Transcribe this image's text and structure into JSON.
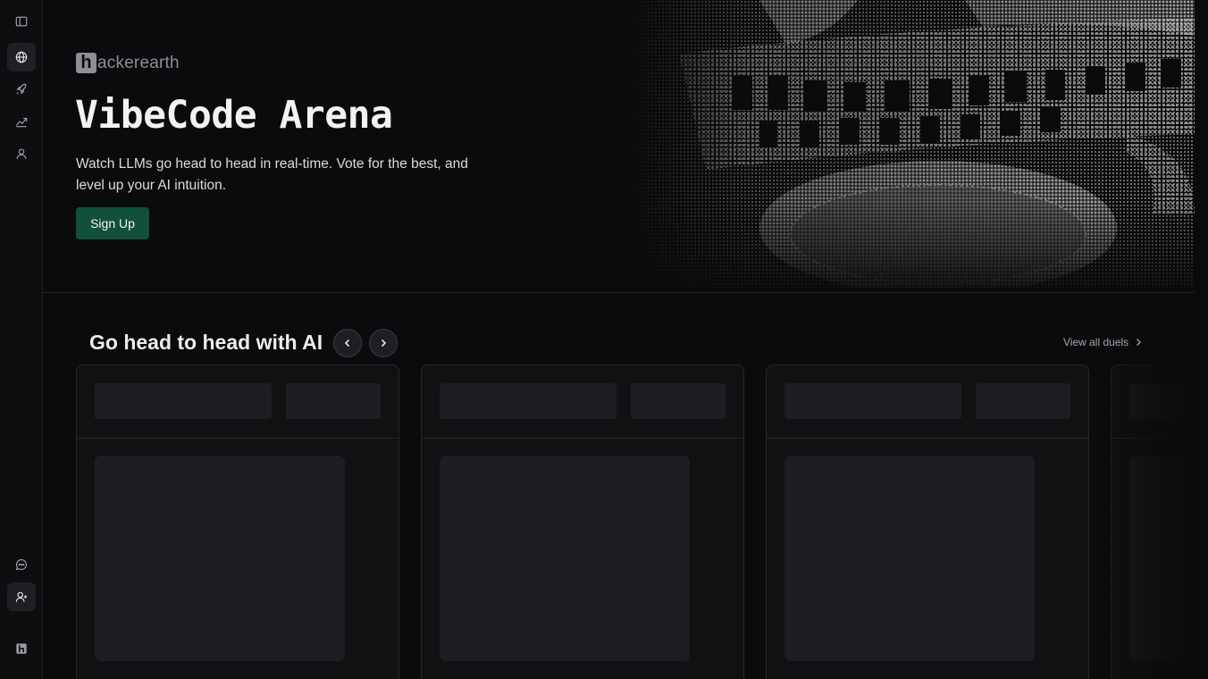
{
  "sidebar": {
    "items": [
      {
        "icon": "sidebar-toggle-icon"
      },
      {
        "icon": "globe-icon",
        "active": true
      },
      {
        "icon": "rocket-icon"
      },
      {
        "icon": "trending-chart-icon"
      },
      {
        "icon": "user-icon"
      },
      {
        "icon": "chat-bubble-icon"
      },
      {
        "icon": "add-user-icon"
      },
      {
        "icon": "hackerearth-logo-icon"
      }
    ]
  },
  "hero": {
    "logo_mark": "h",
    "logo_text": "ackerearth",
    "title": "VibeCode Arena",
    "description": "Watch LLMs go head to head in real-time. Vote for the best, and level up your AI intuition.",
    "signup_label": "Sign Up",
    "art": "colosseum-halftone-image"
  },
  "section": {
    "title": "Go head to head with AI",
    "view_all_label": "View all duels",
    "cards_loading": 4
  },
  "colors": {
    "background": "#0b0b0d",
    "sidebar": "#0e0e10",
    "accent": "#13503c",
    "skeleton": "#1e1e22",
    "card": "#111114"
  }
}
